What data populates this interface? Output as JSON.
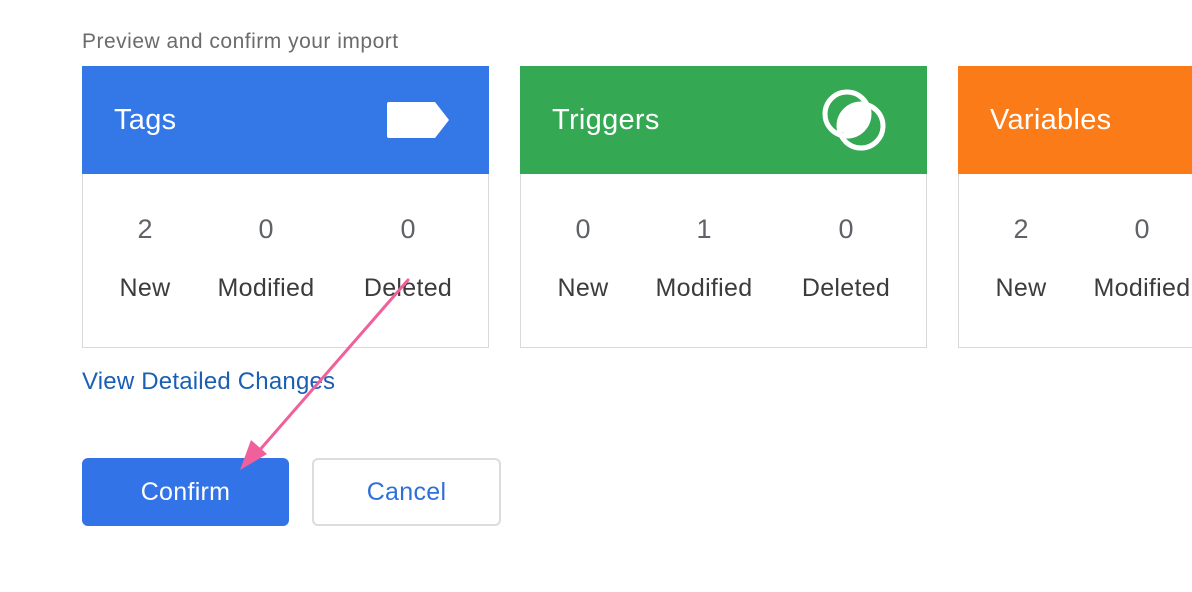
{
  "subtitle": "Preview and confirm your import",
  "cards": [
    {
      "title": "Tags",
      "color": "#3478e8",
      "icon": "tag-icon",
      "stats": [
        {
          "value": "2",
          "label": "New"
        },
        {
          "value": "0",
          "label": "Modified"
        },
        {
          "value": "0",
          "label": "Deleted"
        }
      ]
    },
    {
      "title": "Triggers",
      "color": "#34a853",
      "icon": "trigger-circles-icon",
      "stats": [
        {
          "value": "0",
          "label": "New"
        },
        {
          "value": "1",
          "label": "Modified"
        },
        {
          "value": "0",
          "label": "Deleted"
        }
      ]
    },
    {
      "title": "Variables",
      "color": "#fa7b17",
      "icon": "",
      "stats": [
        {
          "value": "2",
          "label": "New"
        },
        {
          "value": "0",
          "label": "Modified"
        }
      ]
    }
  ],
  "view_changes_link": "View Detailed Changes",
  "actions": {
    "confirm_label": "Confirm",
    "cancel_label": "Cancel"
  },
  "annotation": {
    "arrow_color": "#f0609a"
  }
}
